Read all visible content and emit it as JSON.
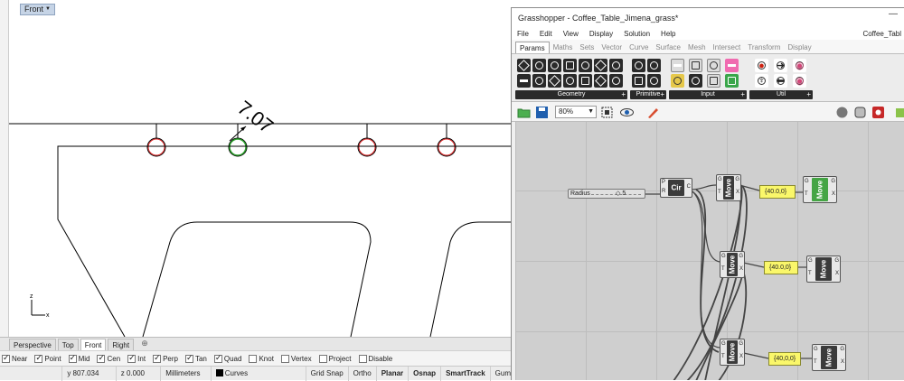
{
  "rhino": {
    "viewport_title": "Front",
    "dimension_text": "7.07",
    "axis_x": "x",
    "axis_z": "z",
    "view_tabs": [
      "Perspective",
      "Top",
      "Front",
      "Right"
    ],
    "active_view": "Front",
    "osnaps": [
      {
        "label": "Near",
        "checked": true
      },
      {
        "label": "Point",
        "checked": true
      },
      {
        "label": "Mid",
        "checked": true
      },
      {
        "label": "Cen",
        "checked": true
      },
      {
        "label": "Int",
        "checked": true
      },
      {
        "label": "Perp",
        "checked": true
      },
      {
        "label": "Tan",
        "checked": true
      },
      {
        "label": "Quad",
        "checked": true
      },
      {
        "label": "Knot",
        "checked": false
      },
      {
        "label": "Vertex",
        "checked": false
      },
      {
        "label": "Project",
        "checked": false
      },
      {
        "label": "Disable",
        "checked": false
      }
    ],
    "status": {
      "y": "y 807.034",
      "z": "z 0.000",
      "units": "Millimeters",
      "layer": "Curves",
      "grid_snap": "Grid Snap",
      "ortho": "Ortho",
      "planar": "Planar",
      "osnap": "Osnap",
      "smarttrack": "SmartTrack",
      "gumball": "Gum"
    }
  },
  "grasshopper": {
    "title": "Grasshopper - Coffee_Table_Jimena_grass*",
    "doc_name": "Coffee_Tabl",
    "menu": [
      "File",
      "Edit",
      "View",
      "Display",
      "Solution",
      "Help"
    ],
    "tabs": [
      "Params",
      "Maths",
      "Sets",
      "Vector",
      "Curve",
      "Surface",
      "Mesh",
      "Intersect",
      "Transform",
      "Display"
    ],
    "active_tab": "Params",
    "panels": [
      "Geometry",
      "Primitive",
      "Input",
      "Util"
    ],
    "zoom": "80%",
    "slider": {
      "label": "Radius",
      "value": "◇ 5"
    },
    "circle_component": {
      "label": "Cir",
      "pins": [
        "P",
        "R"
      ],
      "out": "C"
    },
    "move_components": [
      {
        "label": "Move",
        "in": [
          "G",
          "T"
        ],
        "out": [
          "G",
          "X"
        ]
      },
      {
        "label": "Move",
        "in": [
          "G",
          "T"
        ],
        "out": [
          "G",
          "X"
        ]
      },
      {
        "label": "Move",
        "in": [
          "G",
          "T"
        ],
        "out": [
          "G",
          "X"
        ]
      },
      {
        "label": "Move",
        "in": [
          "G",
          "T"
        ],
        "out": [
          "G",
          "X"
        ]
      },
      {
        "label": "Move",
        "in": [
          "G",
          "T"
        ],
        "out": [
          "G",
          "X"
        ]
      },
      {
        "label": "Move",
        "in": [
          "G",
          "T"
        ],
        "out": [
          "G",
          "X"
        ]
      }
    ],
    "vector_panels": [
      "{40.0,0}",
      "{40.0,0}",
      "{40,0,0}"
    ],
    "colors": {
      "accent_green": "#45a545",
      "panel_yellow": "#faf76a",
      "canvas": "#cfcfcf"
    }
  }
}
